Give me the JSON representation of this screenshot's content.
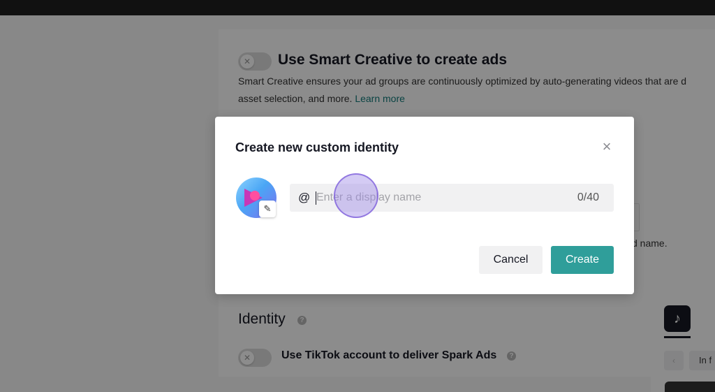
{
  "smart_creative": {
    "title": "Use Smart Creative to create ads",
    "description": "Smart Creative ensures your ad groups are continuously optimized by auto-generating videos that are d",
    "description_line2": "asset selection, and more.",
    "learn_more": "Learn more"
  },
  "background_fragment": {
    "tail_text": "d name."
  },
  "identity": {
    "title": "Identity",
    "spark_ads_label": "Use TikTok account to deliver Spark Ads"
  },
  "preview": {
    "feed_label": "In f"
  },
  "modal": {
    "title": "Create new custom identity",
    "close_symbol": "×",
    "at_symbol": "@",
    "display_name_value": "",
    "display_name_placeholder": "Enter a display name",
    "char_count": "0/40",
    "cancel_label": "Cancel",
    "create_label": "Create"
  },
  "colors": {
    "accent": "#2f9e9a",
    "link": "#127a7a",
    "overlay": "rgba(0,0,0,0.45)"
  },
  "icons": {
    "close": "close-icon",
    "edit": "pencil-icon",
    "help": "question-circle-icon",
    "tiktok": "tiktok-logo-icon"
  }
}
